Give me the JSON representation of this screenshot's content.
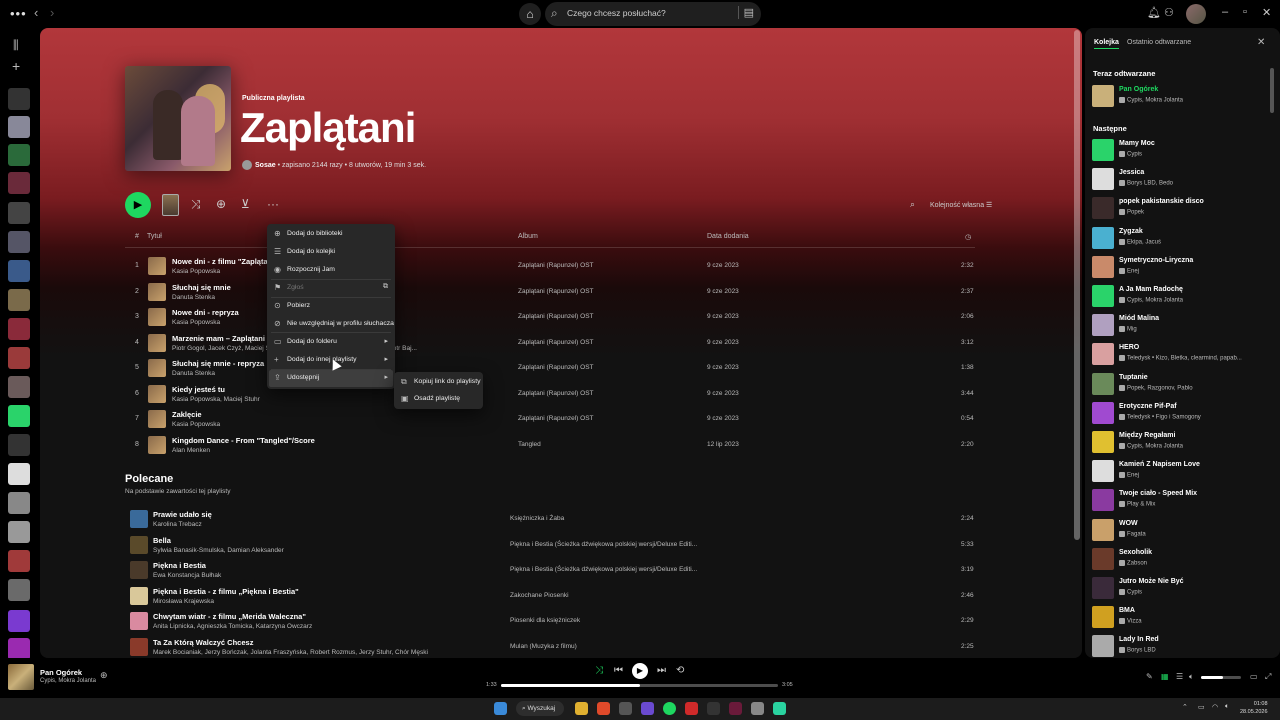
{
  "topbar": {
    "search_placeholder": "Czego chcesz posłuchać?",
    "icons": [
      "more-icon",
      "back-icon",
      "forward-icon",
      "home-icon",
      "search-icon",
      "browse-icon",
      "bell-icon",
      "friends-icon",
      "minimize-icon",
      "maximize-icon",
      "close-icon"
    ]
  },
  "playlist": {
    "type": "Publiczna playlista",
    "title": "Zaplątani",
    "owner": "Sosae",
    "meta": " • zapisano 2144 razy • 8 utworów, 19 min 3 sek."
  },
  "controls": {
    "sort_label": "Kolejność własna"
  },
  "table": {
    "headers": [
      "#",
      "Tytuł",
      "Album",
      "Data dodania"
    ],
    "rows": [
      {
        "num": "1",
        "title": "Nowe dni - z filmu \"Zaplątani\"",
        "artist": "Kasia Popowska",
        "album": "Zaplątani (Rapunzel) OST",
        "date": "9 cze 2023",
        "dur": "2:32"
      },
      {
        "num": "2",
        "title": "Słuchaj się mnie",
        "artist": "Danuta Stenka",
        "album": "Zaplątani (Rapunzel) OST",
        "date": "9 cze 2023",
        "dur": "2:37"
      },
      {
        "num": "3",
        "title": "Nowe dni - repryza",
        "artist": "Kasia Popowska",
        "album": "Zaplątani (Rapunzel) OST",
        "date": "9 cze 2023",
        "dur": "2:06"
      },
      {
        "num": "4",
        "title": "Marzenie mam – Zaplątani",
        "artist": "Piotr Gogol, Jacek Czyż, Maciej Stuhr, Piotr Szydłowski, Kasia Popowska, Piotr Baj...",
        "album": "Zaplątani (Rapunzel) OST",
        "date": "9 cze 2023",
        "dur": "3:12"
      },
      {
        "num": "5",
        "title": "Słuchaj się mnie - repryza",
        "artist": "Danuta Stenka",
        "album": "Zaplątani (Rapunzel) OST",
        "date": "9 cze 2023",
        "dur": "1:38"
      },
      {
        "num": "6",
        "title": "Kiedy jesteś tu",
        "artist": "Kasia Popowska, Maciej Stuhr",
        "album": "Zaplątani (Rapunzel) OST",
        "date": "9 cze 2023",
        "dur": "3:44"
      },
      {
        "num": "7",
        "title": "Zaklęcie",
        "artist": "Kasia Popowska",
        "album": "Zaplątani (Rapunzel) OST",
        "date": "9 cze 2023",
        "dur": "0:54"
      },
      {
        "num": "8",
        "title": "Kingdom Dance - From \"Tangled\"/Score",
        "artist": "Alan Menken",
        "album": "Tangled",
        "date": "12 lip 2023",
        "dur": "2:20"
      }
    ]
  },
  "recommended": {
    "title": "Polecane",
    "subtitle": "Na podstawie zawartości tej playlisty",
    "rows": [
      {
        "title": "Prawie udało się",
        "artist": "Karolina Trebacz",
        "album": "Księżniczka i Żaba",
        "dur": "2:24",
        "color": "#3a6a9a"
      },
      {
        "title": "Bella",
        "artist": "Sylwia Banasik-Smulska, Damian Aleksander",
        "album": "Piękna i Bestia (Ścieżka dźwiękowa polskiej wersji/Deluxe Editi...",
        "dur": "5:33",
        "color": "#5a4a2a"
      },
      {
        "title": "Piękna i Bestia",
        "artist": "Ewa Konstancja Bułhak",
        "album": "Piękna i Bestia (Ścieżka dźwiękowa polskiej wersji/Deluxe Editi...",
        "dur": "3:19",
        "color": "#4a3a2a"
      },
      {
        "title": "Piękna i Bestia - z filmu „Piękna i Bestia\"",
        "artist": "Mirosława Krajewska",
        "album": "Zakochane Piosenki",
        "dur": "2:46",
        "color": "#d9c89a"
      },
      {
        "title": "Chwytam wiatr - z filmu „Merida Waleczna\"",
        "artist": "Anita Lipnicka, Agnieszka Tomicka, Katarzyna Owczarz",
        "album": "Piosenki dla księżniczek",
        "dur": "2:29",
        "color": "#d98aa0"
      },
      {
        "title": "Ta Za Którą Walczyć Chcesz",
        "artist": "Marek Bocianiak, Jerzy Bończak, Jolanta Fraszyńska, Robert Rozmus, Jerzy Stuhr, Chór Męski",
        "album": "Mulan (Muzyka z filmu)",
        "dur": "2:25",
        "color": "#8a3a2a"
      }
    ]
  },
  "context_menu": {
    "items": [
      {
        "icon": "⊕",
        "label": "Dodaj do biblioteki"
      },
      {
        "icon": "☰",
        "label": "Dodaj do kolejki"
      },
      {
        "icon": "◉",
        "label": "Rozpocznij Jam"
      },
      {
        "icon": "⚑",
        "label": "Zgłoś"
      },
      {
        "icon": "⊙",
        "label": "Pobierz"
      },
      {
        "icon": "⊘",
        "label": "Nie uwzględniaj w profilu słuchacza"
      },
      {
        "icon": "▭",
        "label": "Dodaj do folderu"
      },
      {
        "icon": "+",
        "label": "Dodaj do innej playlisty"
      },
      {
        "icon": "⇪",
        "label": "Udostępnij"
      }
    ],
    "submenu": [
      {
        "icon": "⧉",
        "label": "Kopiuj link do playlisty"
      },
      {
        "icon": "▣",
        "label": "Osadź playlistę"
      }
    ]
  },
  "queue": {
    "tab_queue": "Kolejka",
    "tab_recent": "Ostatnio odtwarzane",
    "now_playing_header": "Teraz odtwarzane",
    "now_playing": {
      "title": "Pan Ogórek",
      "artist": "Cypis, Mokra Jolanta",
      "color": "#c9b07a"
    },
    "next_header": "Następne",
    "items": [
      {
        "title": "Mamy Moc",
        "artist": "Cypis",
        "color": "#2ad36a"
      },
      {
        "title": "Jessica",
        "artist": "Borys LBD, Bedo",
        "color": "#ddd"
      },
      {
        "title": "popek pakistanskie disco",
        "artist": "Popek",
        "color": "#3a2a2a"
      },
      {
        "title": "Zygzak",
        "artist": "Ekipa, Jacuś",
        "color": "#4ab0d0"
      },
      {
        "title": "Symetryczno-Liryczna",
        "artist": "Enej",
        "color": "#c98a6a"
      },
      {
        "title": "A Ja Mam Radochę",
        "artist": "Cypis, Mokra Jolanta",
        "color": "#2ad36a"
      },
      {
        "title": "Miód Malina",
        "artist": "Mig",
        "color": "#b0a0c0"
      },
      {
        "title": "HERO",
        "artist": "Teledysk • Kizo, Bletka, clearmind, papab...",
        "color": "#d9a0a0"
      },
      {
        "title": "Tuptanie",
        "artist": "Popek, Razgonov, Pablo",
        "color": "#6a8a5a"
      },
      {
        "title": "Erotyczne Pif-Paf",
        "artist": "Teledysk • Figo i Samogony",
        "color": "#a04ad0"
      },
      {
        "title": "Między Regałami",
        "artist": "Cypis, Mokra Jolanta",
        "color": "#e0c030"
      },
      {
        "title": "Kamień Z Napisem Love",
        "artist": "Enej",
        "color": "#ddd"
      },
      {
        "title": "Twoje ciało - Speed Mix",
        "artist": "Play & Mix",
        "color": "#8a3aa0"
      },
      {
        "title": "WOW",
        "artist": "Fagata",
        "color": "#c9a06a"
      },
      {
        "title": "Sexoholik",
        "artist": "Zabson",
        "color": "#6a3a2a"
      },
      {
        "title": "Jutro Może Nie Być",
        "artist": "Cypis",
        "color": "#3a2a3a"
      },
      {
        "title": "BMA",
        "artist": "Vizza",
        "color": "#d0a020"
      },
      {
        "title": "Lady In Red",
        "artist": "Borys LBD",
        "color": "#aaa"
      }
    ]
  },
  "player": {
    "title": "Pan Ogórek",
    "artist": "Cypis, Mokra Jolanta",
    "current": "1:33",
    "total": "3:05",
    "progress": 0.5,
    "volume": 0.55
  },
  "taskbar": {
    "search": "Wyszukaj",
    "time": "01:08",
    "date": "28.05.2026"
  }
}
